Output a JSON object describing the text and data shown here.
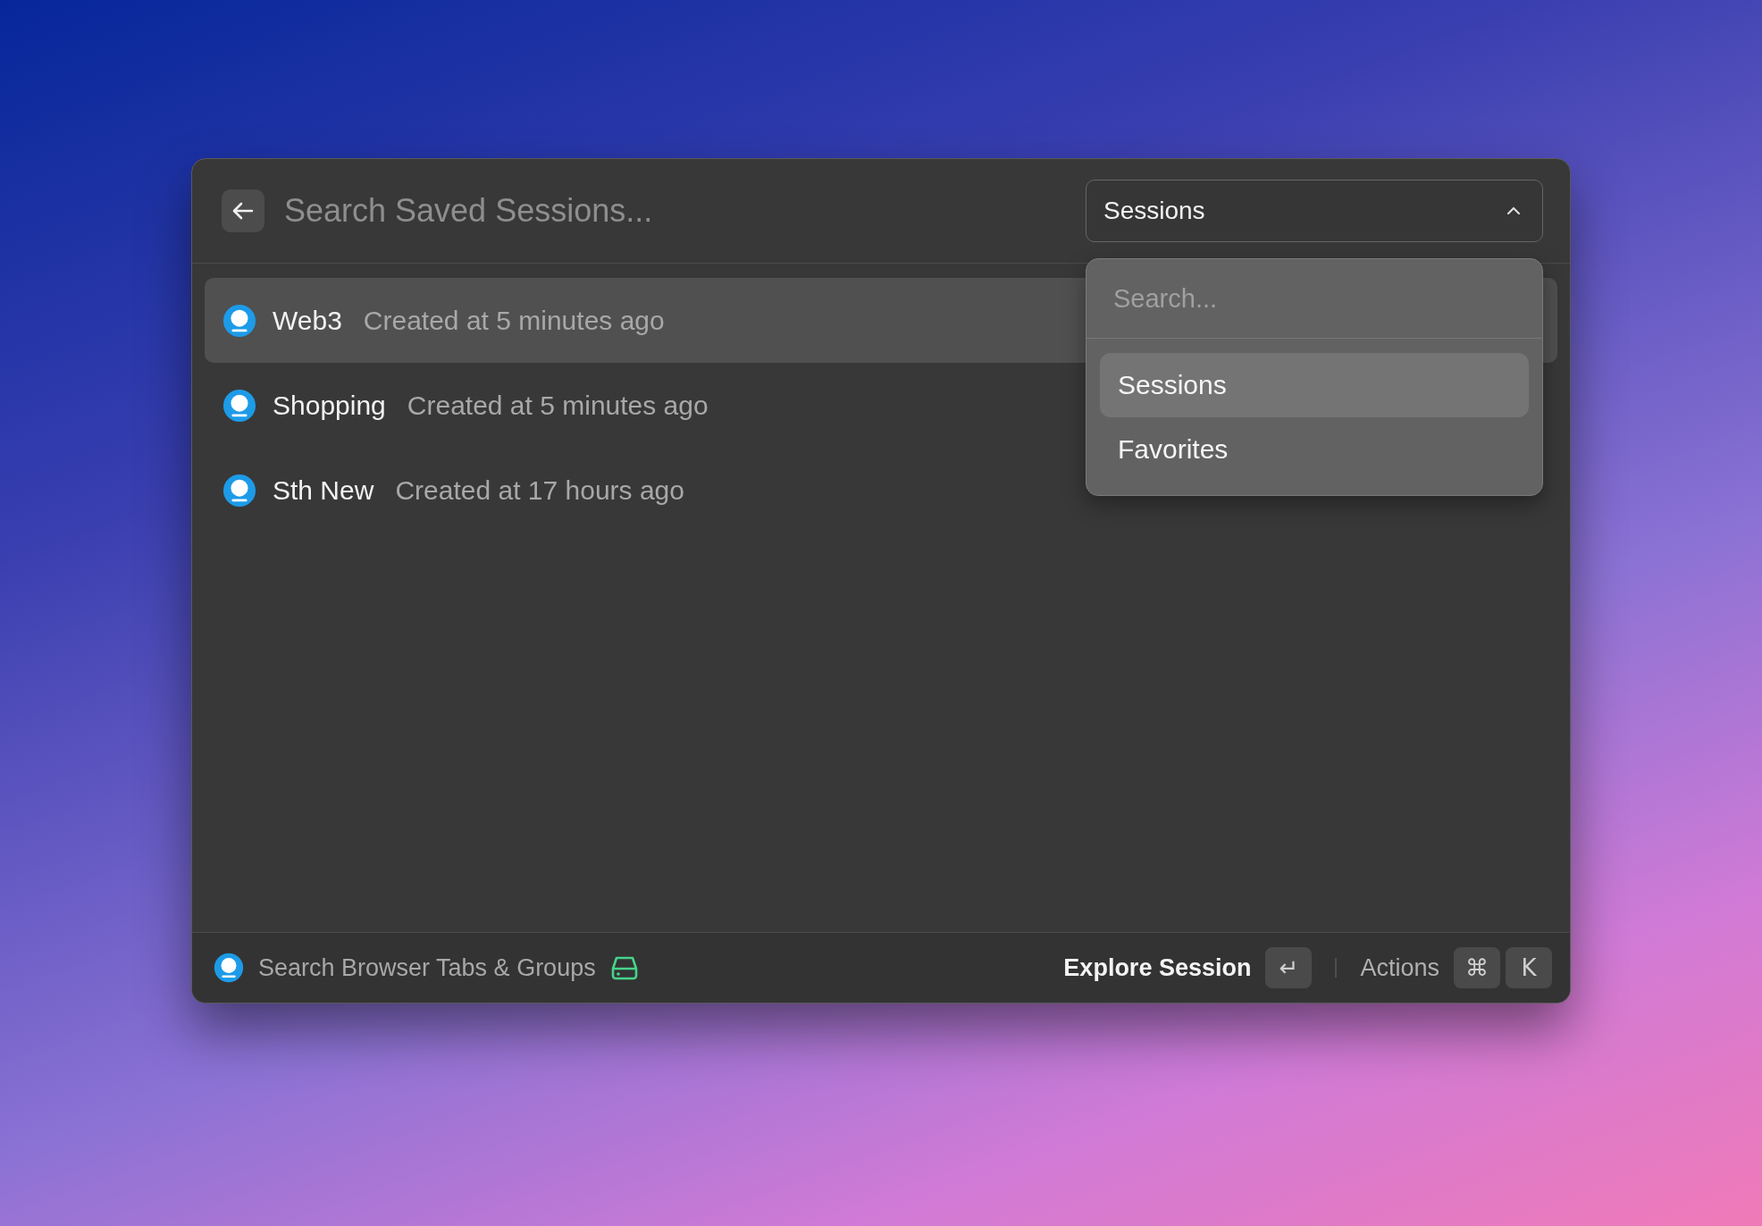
{
  "header": {
    "search": {
      "placeholder": "Search Saved Sessions..."
    },
    "filter": {
      "value": "Sessions",
      "expanded": true
    }
  },
  "dropdown": {
    "search": {
      "placeholder": "Search..."
    },
    "options": [
      {
        "label": "Sessions",
        "selected": true
      },
      {
        "label": "Favorites",
        "selected": false
      }
    ]
  },
  "sessions": [
    {
      "name": "Web3",
      "created": "Created at 5 minutes ago",
      "selected": true
    },
    {
      "name": "Shopping",
      "created": "Created at 5 minutes ago",
      "selected": false
    },
    {
      "name": "Sth New",
      "created": "Created at 17 hours ago",
      "selected": false
    }
  ],
  "footer": {
    "title": "Search Browser Tabs & Groups",
    "primary_action": "Explore Session",
    "primary_key": "↵",
    "secondary_action": "Actions",
    "secondary_keys": [
      "⌘",
      "K"
    ]
  }
}
